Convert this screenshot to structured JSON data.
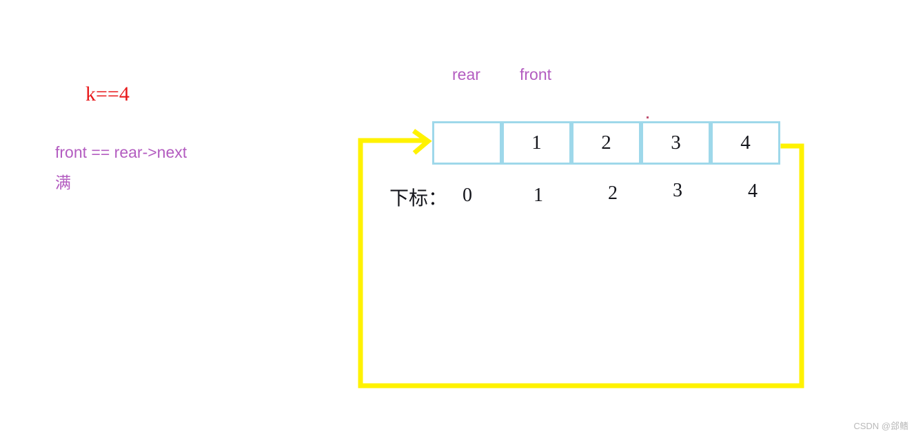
{
  "annotations": {
    "k_value": "k==4",
    "condition": "front == rear->next",
    "state": "满"
  },
  "pointers": {
    "rear_label": "rear",
    "front_label": "front"
  },
  "array": {
    "cells": [
      {
        "value": "",
        "index": "0"
      },
      {
        "value": "1",
        "index": "1"
      },
      {
        "value": "2",
        "index": "2"
      },
      {
        "value": "3",
        "index": "3"
      },
      {
        "value": "4",
        "index": "4"
      }
    ],
    "index_caption": "下标："
  },
  "colors": {
    "cell_border": "#9ed8ea",
    "annotation_red": "#e8191b",
    "annotation_purple": "#b35cc0",
    "wrap_arrow_yellow": "#fff200",
    "text_black": "#15161c"
  },
  "watermark": "CSDN @郐鳍"
}
